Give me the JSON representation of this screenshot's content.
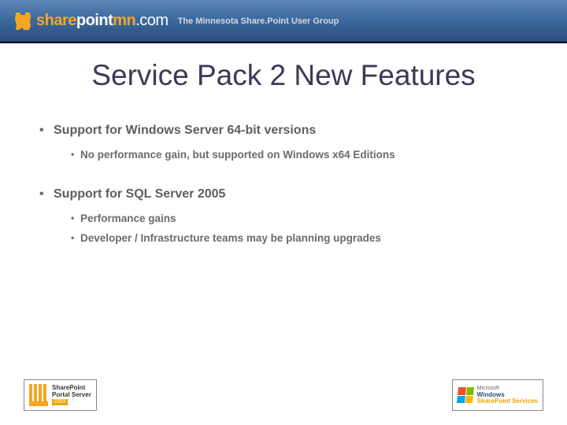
{
  "header": {
    "logo_share": "share",
    "logo_point": "point",
    "logo_mn": "mn",
    "logo_com": ".com",
    "subtitle": "The Minnesota Share.Point User Group"
  },
  "title": "Service Pack 2 New Features",
  "bullets": {
    "b1": "Support for Windows Server 64-bit versions",
    "b1_1": "No performance gain, but supported on Windows x64 Editions",
    "b2": "Support for SQL Server 2005",
    "b2_1": "Performance gains",
    "b2_2": "Developer / Infrastructure teams may be planning upgrades"
  },
  "badges": {
    "left_line1": "SharePoint",
    "left_line2": "Portal Server",
    "left_year": "2003",
    "right_ms": "Microsoft",
    "right_windows": "Windows",
    "right_sps": "SharePoint Services"
  }
}
